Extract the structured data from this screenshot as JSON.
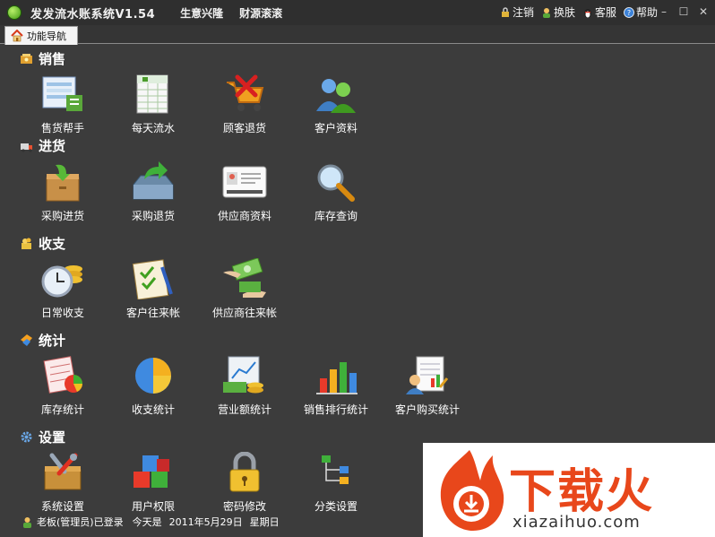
{
  "window": {
    "title": "发发流水账系统V1.54",
    "slogan1": "生意兴隆",
    "slogan2": "财源滚滚",
    "actions": [
      {
        "label": "注销",
        "icon": "lock-icon"
      },
      {
        "label": "换肤",
        "icon": "person-icon"
      },
      {
        "label": "客服",
        "icon": "penguin-icon"
      },
      {
        "label": "帮助",
        "icon": "help-icon"
      }
    ],
    "controls": {
      "minimize": "–",
      "maximize": "☐",
      "close": "✕"
    }
  },
  "tab": {
    "label": "功能导航",
    "icon": "home-icon"
  },
  "sections": {
    "sales": {
      "title": "销售",
      "items": [
        {
          "label": "售货帮手",
          "icon": "sales-helper-icon"
        },
        {
          "label": "每天流水",
          "icon": "daily-ledger-icon"
        },
        {
          "label": "顾客退货",
          "icon": "cart-return-icon"
        },
        {
          "label": "客户资料",
          "icon": "customers-icon"
        }
      ]
    },
    "purchase": {
      "title": "进货",
      "items": [
        {
          "label": "采购进货",
          "icon": "purchase-box-icon"
        },
        {
          "label": "采购退货",
          "icon": "purchase-return-icon"
        },
        {
          "label": "供应商资料",
          "icon": "supplier-card-icon"
        },
        {
          "label": "库存查询",
          "icon": "magnifier-icon"
        }
      ]
    },
    "finance": {
      "title": "收支",
      "items": [
        {
          "label": "日常收支",
          "icon": "clock-coins-icon"
        },
        {
          "label": "客户往来帐",
          "icon": "checklist-icon"
        },
        {
          "label": "供应商往来帐",
          "icon": "money-hands-icon"
        }
      ]
    },
    "stats": {
      "title": "统计",
      "items": [
        {
          "label": "库存统计",
          "icon": "stock-chart-icon"
        },
        {
          "label": "收支统计",
          "icon": "pie-icon"
        },
        {
          "label": "营业额统计",
          "icon": "revenue-icon"
        },
        {
          "label": "销售排行统计",
          "icon": "bar-chart-icon"
        },
        {
          "label": "客户购买统计",
          "icon": "customer-report-icon"
        }
      ]
    },
    "settings": {
      "title": "设置",
      "items": [
        {
          "label": "系统设置",
          "icon": "tools-icon"
        },
        {
          "label": "用户权限",
          "icon": "blocks-icon"
        },
        {
          "label": "密码修改",
          "icon": "padlock-icon"
        },
        {
          "label": "分类设置",
          "icon": "tree-icon"
        }
      ]
    }
  },
  "status": {
    "user": "老板(管理员)已登录",
    "today_label": "今天是",
    "date": "2011年5月29日",
    "weekday": "星期日"
  },
  "watermark": {
    "brand": "下载火",
    "url": "xiazaihuo.com"
  },
  "colors": {
    "background": "#3c3c3c",
    "titlebar": "#2f2f2f",
    "watermark_accent": "#e8471b"
  }
}
